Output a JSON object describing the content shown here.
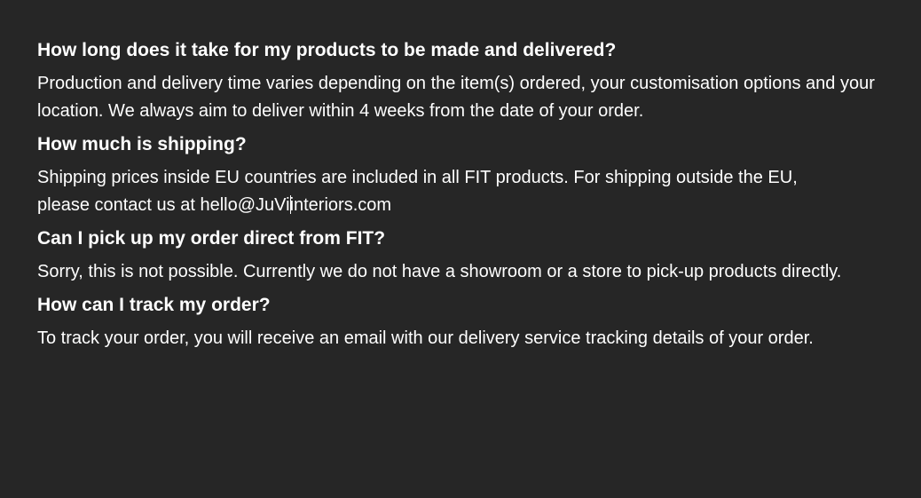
{
  "faq": [
    {
      "question": "How long does it take for my products to be made and delivered?",
      "answer": "Production and delivery time varies depending on the item(s) ordered, your customisation options and your location. We always aim to deliver within 4 weeks from the date of your order."
    },
    {
      "question": "How much is shipping?",
      "answer_line1": "Shipping prices inside EU countries are included in all FIT products. For shipping outside the EU,",
      "answer_line2_before_caret": "please contact us at hello@JuVi",
      "answer_line2_after_caret": "interiors.com"
    },
    {
      "question": "Can I pick up my order direct from FIT?",
      "answer": "Sorry, this is not possible. Currently we do not have a showroom or a store to pick-up products directly."
    },
    {
      "question": "How can I track my order?",
      "answer": "To track your order, you will receive an email with our delivery service tracking details of your order."
    }
  ]
}
